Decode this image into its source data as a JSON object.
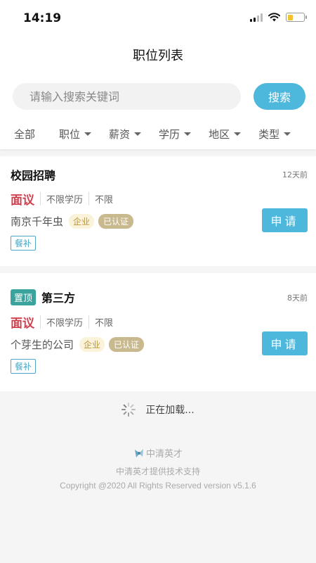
{
  "status_bar": {
    "time": "14:19",
    "battery_level": 0.35
  },
  "nav": {
    "title": "职位列表"
  },
  "search": {
    "placeholder": "请输入搜索关键词",
    "button_label": "搜索"
  },
  "filters": [
    {
      "label": "全部",
      "dropdown": false
    },
    {
      "label": "职位",
      "dropdown": true
    },
    {
      "label": "薪资",
      "dropdown": true
    },
    {
      "label": "学历",
      "dropdown": true
    },
    {
      "label": "地区",
      "dropdown": true
    },
    {
      "label": "类型",
      "dropdown": true
    }
  ],
  "jobs": [
    {
      "badge": "",
      "title": "校园招聘",
      "posted": "12天前",
      "salary": "面议",
      "education": "不限学历",
      "experience": "不限",
      "company": "南京千年虫",
      "tag_type": "企业",
      "tag_verified": "已认证",
      "apply_label": "申请",
      "benefit": "餐补"
    },
    {
      "badge": "置顶",
      "title": "第三方",
      "posted": "8天前",
      "salary": "面议",
      "education": "不限学历",
      "experience": "不限",
      "company": "个芽生的公司",
      "tag_type": "企业",
      "tag_verified": "已认证",
      "apply_label": "申请",
      "benefit": "餐补"
    }
  ],
  "loading": {
    "text": "正在加载..."
  },
  "footer": {
    "brand": "中清英才",
    "support": "中清英才提供技术支持",
    "copyright": "Copyright @2020 All Rights Reserved version v5.1.6"
  },
  "colors": {
    "accent": "#4db8dc",
    "salary": "#d0404f",
    "top_badge": "#3aa39e",
    "verified_tag": "#c9b98f",
    "company_tag": "#b8953e"
  },
  "icons": [
    "signal-icon",
    "wifi-icon",
    "battery-icon",
    "chevron-down-icon",
    "loading-spinner-icon",
    "brand-logo-icon"
  ]
}
